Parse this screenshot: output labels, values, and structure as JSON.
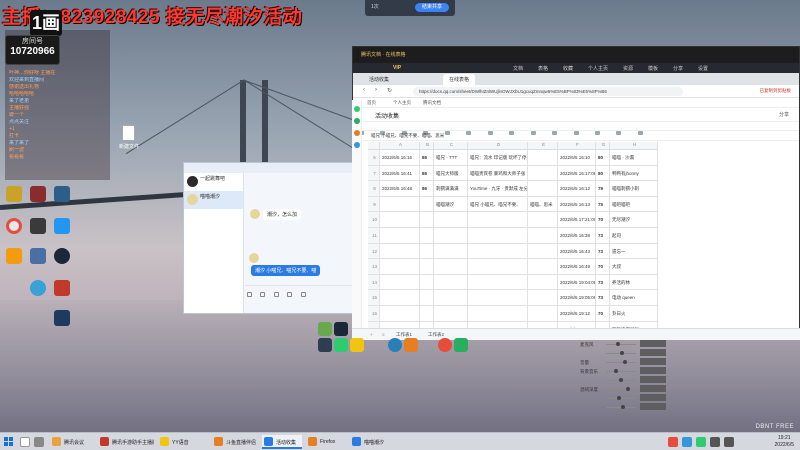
{
  "stream": {
    "title": "主播：823928425 接无尽潮汐活动",
    "badge": "1画",
    "room_label": "房间号",
    "room_number": "10720966",
    "chat_lines": [
      "叶神…你好呀 主播在",
      "欢迎来到直播间",
      "感谢送出礼物",
      "哈哈哈哈哈",
      "来了老弟",
      "主播好强",
      "蹲一个",
      "点点关注",
      "+1",
      "打卡",
      "来了来了",
      "刷一波",
      "看看看"
    ]
  },
  "desktop": {
    "file_label": "新建文件"
  },
  "topbar": {
    "label": "1次",
    "button": "结束共享"
  },
  "qq": {
    "header": "",
    "header_right": "",
    "contacts": [
      {
        "name": "一起跳舞吧",
        "sub": "",
        "time": "",
        "selected": false
      },
      {
        "name": "喵喵潮汐",
        "sub": "",
        "time": "",
        "selected": true
      }
    ],
    "msg_in": "潮汐，怎么加",
    "msg_blue": "潮汐 小喵兄、喵兄不要、喵"
  },
  "docs": {
    "brand": "腾讯文档 · 在线表格",
    "vip": "VIP",
    "nav_items": [
      "文档",
      "表格",
      "收藏",
      "个人主页",
      "资源",
      "模板",
      "分享",
      "设置"
    ],
    "tabs": [
      "活动收集",
      "在线表格"
    ],
    "url": "https://docs.qq.com/sheet/DWlhIZnlWUjlnOWJXbU1gcuqZmnqw6%E5%BF%83%E5%8F%B6",
    "url_right": "已复制到剪贴板",
    "bookmarks": [
      "首页",
      "个人主页",
      "腾讯文档"
    ],
    "title": "活动收集",
    "doc_right": "分享",
    "formula": "喵兄 小喵兄、喵兄不要、喵喵、思米",
    "sheet_tabs": [
      "工作表1",
      "工作表2"
    ],
    "columns": [
      "",
      "A",
      "B",
      "C",
      "D",
      "E",
      "F",
      "G",
      "H"
    ],
    "rows": [
      {
        "rn": "6",
        "time": "2022/6/5 16:16",
        "num": "86",
        "name": "喵兄 · TTT",
        "note": "喵兄：流水 印记版 玩坏了停止",
        "e": "",
        "t2": "2022/6/5 16:10",
        "n2": "80",
        "who": "喵喵 · 沙漏"
      },
      {
        "rn": "7",
        "time": "2022/6/5 16:41",
        "num": "86",
        "name": "喵兄大师版",
        "note": "喵喵贵宾卷 暴鸡和大师子张 已通过",
        "e": "",
        "t2": "2022/6/5 16:17:08",
        "n2": "80",
        "who": "鸭鸭有jhonny"
      },
      {
        "rn": "8",
        "time": "2022/6/5 16:48",
        "num": "86",
        "name": "刺猬满满满",
        "note": "YouTime · 九牙 · 贵默成 左分多形之域",
        "e": "",
        "t2": "2022/6/5 16:12",
        "n2": "79",
        "who": "喵喵刺猬小刺"
      },
      {
        "rn": "9",
        "time": "",
        "num": "",
        "name": "喵喵潮汐",
        "note": "喵兄 小喵兄、喵兄不要、",
        "e": "喵喵、思米",
        "t2": "2022/6/5 16:13",
        "n2": "75",
        "who": "喵吧喵吧"
      },
      {
        "rn": "10",
        "time": "",
        "num": "",
        "name": "",
        "note": "",
        "e": "",
        "t2": "2022/6/5 17:21:00",
        "n2": "70",
        "who": "无尽潮汐"
      },
      {
        "rn": "11",
        "time": "",
        "num": "",
        "name": "",
        "note": "",
        "e": "",
        "t2": "2022/6/5 16:38",
        "n2": "73",
        "who": "起司"
      },
      {
        "rn": "12",
        "time": "",
        "num": "",
        "name": "",
        "note": "",
        "e": "",
        "t2": "2022/6/5 16:43",
        "n2": "73",
        "who": "遗忘一"
      },
      {
        "rn": "13",
        "time": "",
        "num": "",
        "name": "",
        "note": "",
        "e": "",
        "t2": "2022/6/5 16:49",
        "n2": "70",
        "who": "大叔"
      },
      {
        "rn": "14",
        "time": "",
        "num": "",
        "name": "",
        "note": "",
        "e": "",
        "t2": "2022/6/5 19:04:08",
        "n2": "73",
        "who": "养活的林"
      },
      {
        "rn": "15",
        "time": "",
        "num": "",
        "name": "",
        "note": "",
        "e": "",
        "t2": "2022/6/5 19:05:06",
        "n2": "73",
        "who": "电动 queen"
      },
      {
        "rn": "16",
        "time": "",
        "num": "",
        "name": "",
        "note": "",
        "e": "",
        "t2": "2022/6/5 19:12",
        "n2": "70",
        "who": "卦日火"
      },
      {
        "rn": "17",
        "time": "",
        "num": "",
        "name": "",
        "note": "",
        "e": "",
        "t2": "2022/6/5 19:16:08",
        "n2": "73",
        "who": "万物清潮弹弹"
      }
    ]
  },
  "mixer": {
    "rows": [
      {
        "label": "麦克风",
        "value": "",
        "level": 0.35
      },
      {
        "label": "",
        "value": "",
        "level": 0.5
      },
      {
        "label": "音量",
        "value": "",
        "level": 0.6
      },
      {
        "label": "背景音乐",
        "value": "",
        "level": 0.3
      },
      {
        "label": "",
        "value": "",
        "level": 0.45
      },
      {
        "label": "混响深度",
        "value": "",
        "level": 0.7
      },
      {
        "label": "",
        "value": "",
        "level": 0.4
      },
      {
        "label": "",
        "value": "",
        "level": 0.55
      }
    ]
  },
  "taskbar": {
    "tasks": [
      {
        "label": "腾讯会议",
        "color": "#e8a33d",
        "active": false
      },
      {
        "label": "腾讯手游助手主播版",
        "color": "#c0392b",
        "active": false
      },
      {
        "label": "YY语音",
        "color": "#f1c40f",
        "active": false
      },
      {
        "label": "斗鱼直播伴侣",
        "color": "#e67e22",
        "active": false
      },
      {
        "label": "活动收集",
        "color": "#2a7be4",
        "active": true
      },
      {
        "label": "Firefox",
        "color": "#e67e22",
        "active": false
      },
      {
        "label": "喵喵潮汐",
        "color": "#2a7be4",
        "active": false
      }
    ],
    "time": "19:21",
    "date": "2022/6/5",
    "watermark": "DBNT FREE"
  }
}
